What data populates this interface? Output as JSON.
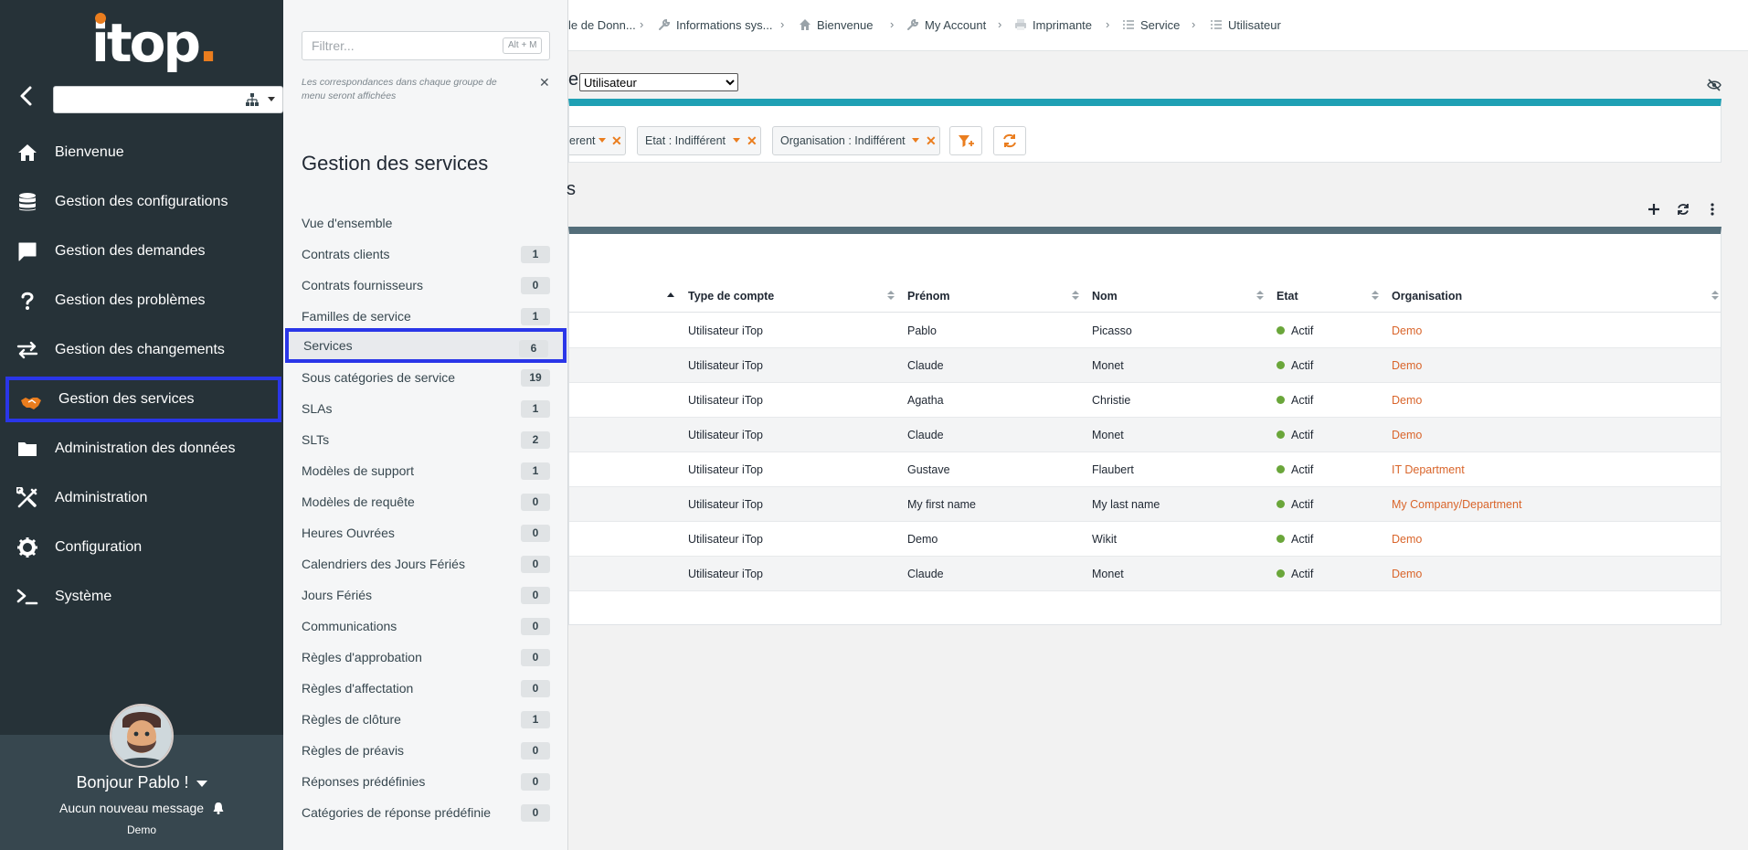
{
  "app": {
    "logo_text": "itop"
  },
  "nav": {
    "groups": [
      {
        "label": "Bienvenue",
        "icon": "home-icon"
      },
      {
        "label": "Gestion des configurations",
        "icon": "database-icon"
      },
      {
        "label": "Gestion des demandes",
        "icon": "comment-icon"
      },
      {
        "label": "Gestion des problèmes",
        "icon": "question-icon"
      },
      {
        "label": "Gestion des changements",
        "icon": "exchange-icon"
      },
      {
        "label": "Gestion des services",
        "icon": "handshake-icon",
        "active": true
      },
      {
        "label": "Administration des données",
        "icon": "folder-icon"
      },
      {
        "label": "Administration",
        "icon": "tools-icon"
      },
      {
        "label": "Configuration",
        "icon": "gear-icon"
      },
      {
        "label": "Système",
        "icon": "terminal-icon"
      }
    ],
    "org_select_value": ""
  },
  "user": {
    "greeting": "Bonjour Pablo !",
    "messages": "Aucun nouveau message",
    "organization": "Demo"
  },
  "drawer": {
    "filter_placeholder": "Filtrer...",
    "filter_shortcut": "Alt + M",
    "hint": "Les correspondances dans chaque groupe de menu seront affichées",
    "title": "Gestion des services",
    "items": [
      {
        "label": "Vue d'ensemble",
        "count": null
      },
      {
        "label": "Contrats clients",
        "count": "1"
      },
      {
        "label": "Contrats fournisseurs",
        "count": "0"
      },
      {
        "label": "Familles de service",
        "count": "1"
      },
      {
        "label": "Services",
        "count": "6",
        "active": true
      },
      {
        "label": "Sous catégories de service",
        "count": "19"
      },
      {
        "label": "SLAs",
        "count": "1"
      },
      {
        "label": "SLTs",
        "count": "2"
      },
      {
        "label": "Modèles de support",
        "count": "1"
      },
      {
        "label": "Modèles de requête",
        "count": "0"
      },
      {
        "label": "Heures Ouvrées",
        "count": "0"
      },
      {
        "label": "Calendriers des Jours Fériés",
        "count": "0"
      },
      {
        "label": "Jours Fériés",
        "count": "0"
      },
      {
        "label": "Communications",
        "count": "0"
      },
      {
        "label": "Règles d'approbation",
        "count": "0"
      },
      {
        "label": "Règles d'affectation",
        "count": "0"
      },
      {
        "label": "Règles de clôture",
        "count": "1"
      },
      {
        "label": "Règles de préavis",
        "count": "0"
      },
      {
        "label": "Réponses prédéfinies",
        "count": "0"
      },
      {
        "label": "Catégories de réponse prédéfinie",
        "count": "0"
      }
    ]
  },
  "breadcrumb": {
    "items": [
      {
        "label": "le de Donn...",
        "icon": ""
      },
      {
        "label": "Informations sys...",
        "icon": "wrench-icon"
      },
      {
        "label": "Bienvenue",
        "icon": "home-icon"
      },
      {
        "label": "My Account",
        "icon": "wrench-icon"
      },
      {
        "label": "Imprimante",
        "icon": "printer-icon"
      },
      {
        "label": "Service",
        "icon": "list-icon"
      },
      {
        "label": "Utilisateur",
        "icon": "list-icon"
      }
    ]
  },
  "search": {
    "header_fragment": "e",
    "class_value": "Utilisateur",
    "criteria": [
      {
        "label": "erent"
      },
      {
        "label": "Etat : Indifférent"
      },
      {
        "label": "Organisation : Indifférent"
      }
    ]
  },
  "results": {
    "title_fragment": "s",
    "columns": [
      "Type de compte",
      "Prénom",
      "Nom",
      "Etat",
      "Organisation"
    ],
    "rows": [
      {
        "type": "Utilisateur iTop",
        "first": "Pablo",
        "last": "Picasso",
        "status": "Actif",
        "org": "Demo"
      },
      {
        "type": "Utilisateur iTop",
        "first": "Claude",
        "last": "Monet",
        "status": "Actif",
        "org": "Demo"
      },
      {
        "type": "Utilisateur iTop",
        "first": "Agatha",
        "last": "Christie",
        "status": "Actif",
        "org": "Demo"
      },
      {
        "type": "Utilisateur iTop",
        "first": "Claude",
        "last": "Monet",
        "status": "Actif",
        "org": "Demo"
      },
      {
        "type": "Utilisateur iTop",
        "first": "Gustave",
        "last": "Flaubert",
        "status": "Actif",
        "org": "IT Department"
      },
      {
        "type": "Utilisateur iTop",
        "first": "My first name",
        "last": "My last name",
        "status": "Actif",
        "org": "My Company/Department"
      },
      {
        "type": "Utilisateur iTop",
        "first": "Demo",
        "last": "Wikit",
        "status": "Actif",
        "org": "Demo"
      },
      {
        "type": "Utilisateur iTop",
        "first": "Claude",
        "last": "Monet",
        "status": "Actif",
        "org": "Demo"
      }
    ]
  },
  "colors": {
    "sidebar_bg": "#263238",
    "accent": "#ea7d1e",
    "highlight": "#2a36e8",
    "criteria_bar": "#1fa0b4",
    "results_bar": "#546e7a",
    "status_active": "#6aa63a",
    "link": "#d9652b"
  }
}
